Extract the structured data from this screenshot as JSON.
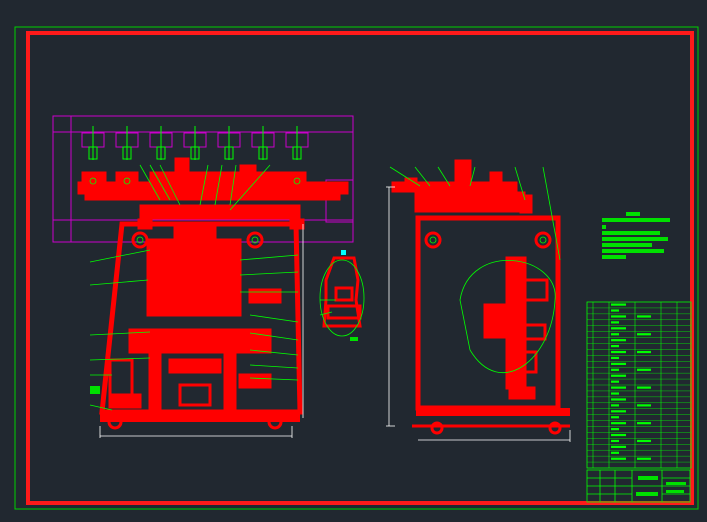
{
  "viewport": {
    "background": "#212830"
  },
  "colors": {
    "frame_outer": "#00d000",
    "frame_inner": "#ff1a1a",
    "geometry": "#ff0000",
    "annotation": "#00ff00",
    "die_outline": "#cc00cc",
    "dimension": "#ffffff",
    "marker": "#00ffff"
  },
  "drawing": {
    "views": [
      {
        "id": "front-view",
        "label": ""
      },
      {
        "id": "side-view",
        "label": ""
      },
      {
        "id": "detail-view",
        "label": ""
      }
    ],
    "technical_requirements": {
      "visible": true,
      "lines": 7
    },
    "parts_list": {
      "columns": 6,
      "rows": 28
    },
    "title_block": {
      "visible": true
    }
  }
}
